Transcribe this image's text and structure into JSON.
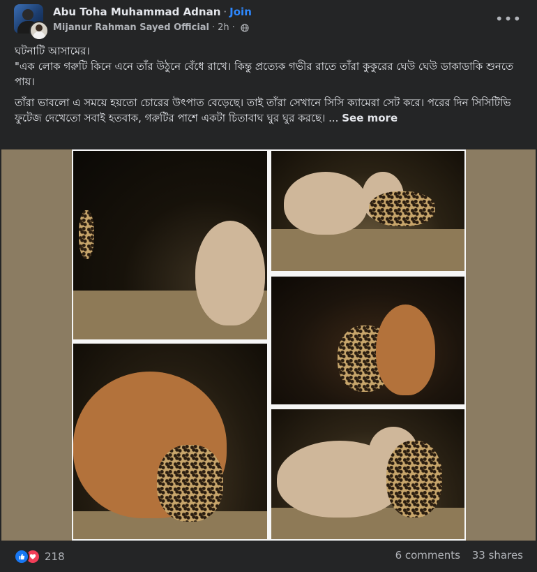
{
  "post": {
    "author": "Abu Toha Muhammad Adnan",
    "separator": "·",
    "join_label": "Join",
    "group": "Mijanur Rahman Sayed Official",
    "time": "2h",
    "time_separator": "·",
    "more_label": "•••",
    "text_line1": "ঘটনাটি আসামের।",
    "text_line2": "\"এক লোক গরুটি কিনে এনে তাঁর উঠুনে বেঁধে রাখে। কিন্তু প্রত্যেক গভীর রাতে তাঁরা কুকুরের ঘেউ ঘেউ ডাকাডাকি শুনতে পায়।",
    "text_para2": "তাঁরা ভাবলো এ সময়ে হয়তো চোরের উৎপাত বেড়েছে। তাই তাঁরা সেখানে সিসি ক্যামেরা সেট করে। পরের দিন সিসিটিভি ফুটেজ দেখেতো সবাই হতবাক, গরুটির পাশে একটা চিতাবাঘ ঘুর ঘুর করছে। ...",
    "see_more": "See more"
  },
  "footer": {
    "reaction_count": "218",
    "comments": "6 comments",
    "shares": "33 shares"
  },
  "icons": {
    "like": "like-icon",
    "love": "love-icon",
    "globe": "globe-icon",
    "more": "more-options-icon"
  },
  "colors": {
    "background": "#242526",
    "join": "#2d88ff",
    "like": "#1877f2",
    "love": "#f33e58"
  }
}
